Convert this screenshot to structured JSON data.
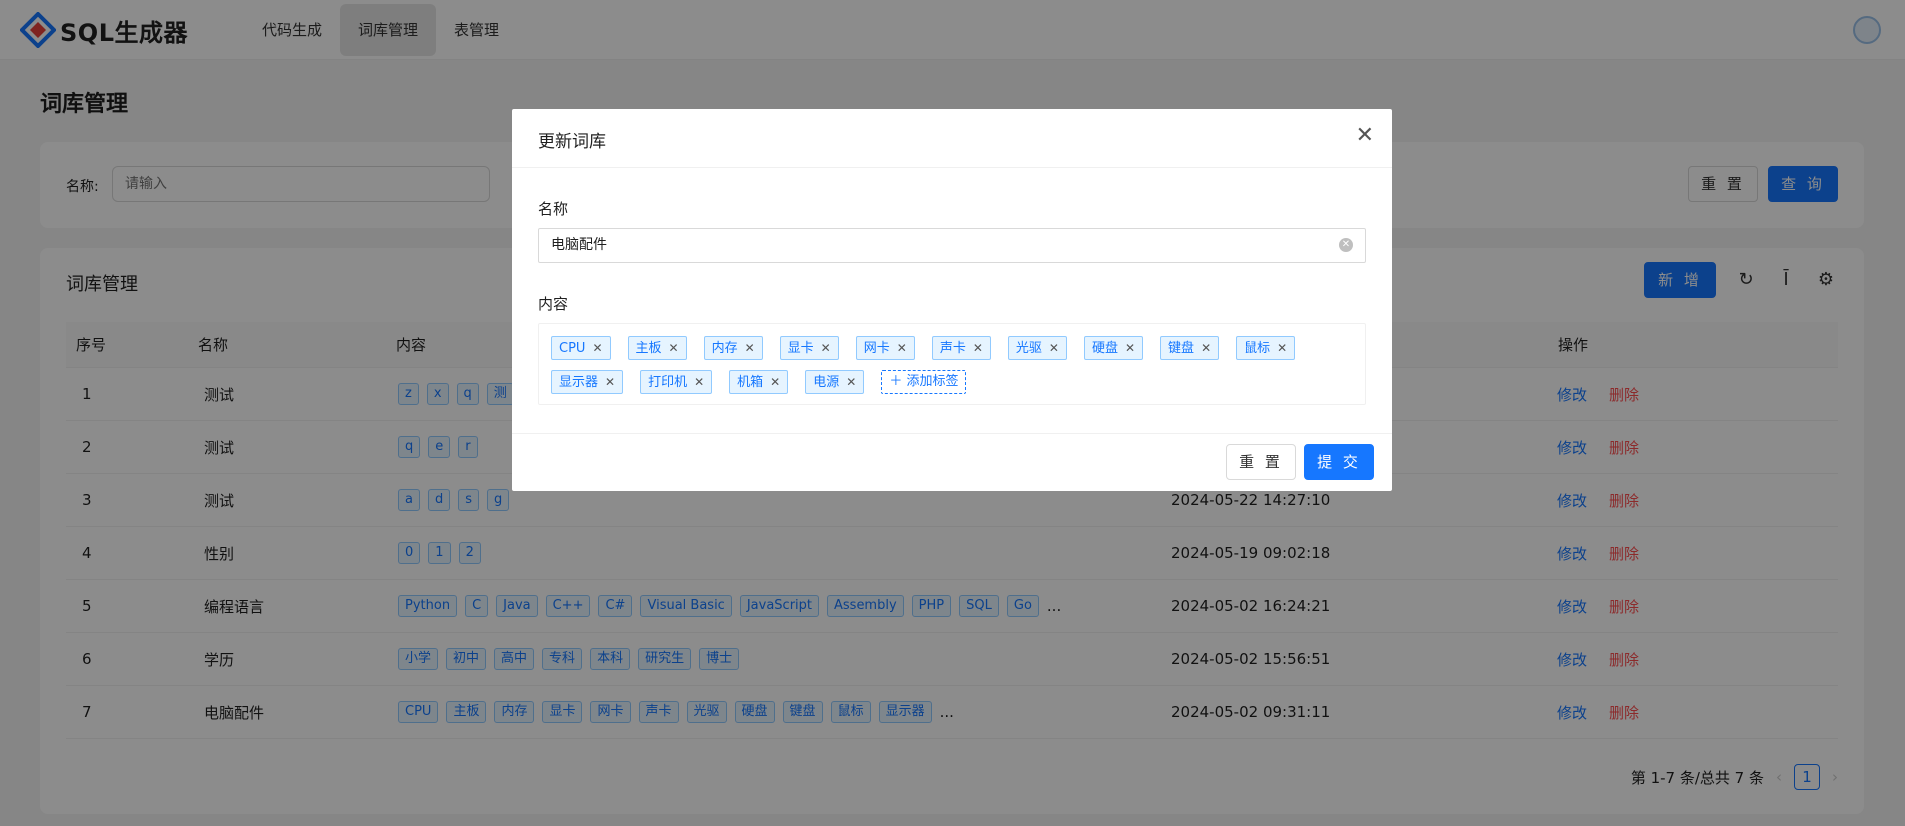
{
  "app": {
    "title": "SQL生成器"
  },
  "nav": {
    "items": [
      {
        "label": "代码生成"
      },
      {
        "label": "词库管理"
      },
      {
        "label": "表管理"
      }
    ]
  },
  "page": {
    "title": "词库管理"
  },
  "search": {
    "label": "名称:",
    "placeholder": "请输入",
    "reset_label": "重 置",
    "query_label": "查 询"
  },
  "table_card": {
    "title": "词库管理",
    "add_label": "新 增",
    "columns": [
      "序号",
      "名称",
      "内容",
      "操作"
    ],
    "edit_label": "修改",
    "delete_label": "删除",
    "rows": [
      {
        "id": "1",
        "name": "测试",
        "tags": [
          "z",
          "x",
          "q",
          "测"
        ],
        "more": "",
        "time": ""
      },
      {
        "id": "2",
        "name": "测试",
        "tags": [
          "q",
          "e",
          "r"
        ],
        "more": "",
        "time": ""
      },
      {
        "id": "3",
        "name": "测试",
        "tags": [
          "a",
          "d",
          "s",
          "g"
        ],
        "more": "",
        "time": "2024-05-22 14:27:10"
      },
      {
        "id": "4",
        "name": "性别",
        "tags": [
          "0",
          "1",
          "2"
        ],
        "more": "",
        "time": "2024-05-19 09:02:18"
      },
      {
        "id": "5",
        "name": "编程语言",
        "tags": [
          "Python",
          "C",
          "Java",
          "C++",
          "C#",
          "Visual Basic",
          "JavaScript",
          "Assembly",
          "PHP",
          "SQL",
          "Go"
        ],
        "more": "...",
        "time": "2024-05-02 16:24:21"
      },
      {
        "id": "6",
        "name": "学历",
        "tags": [
          "小学",
          "初中",
          "高中",
          "专科",
          "本科",
          "研究生",
          "博士"
        ],
        "more": "",
        "time": "2024-05-02 15:56:51"
      },
      {
        "id": "7",
        "name": "电脑配件",
        "tags": [
          "CPU",
          "主板",
          "内存",
          "显卡",
          "网卡",
          "声卡",
          "光驱",
          "硬盘",
          "键盘",
          "鼠标",
          "显示器"
        ],
        "more": "...",
        "time": "2024-05-02 09:31:11"
      }
    ],
    "pagination": {
      "summary": "第 1-7 条/总共 7 条",
      "current": "1"
    }
  },
  "modal": {
    "title": "更新词库",
    "name_label": "名称",
    "name_value": "电脑配件",
    "content_label": "内容",
    "tags_row1": [
      "CPU",
      "主板",
      "内存",
      "显卡",
      "网卡",
      "声卡",
      "光驱",
      "硬盘",
      "键盘",
      "鼠标"
    ],
    "tags_row2": [
      "显示器",
      "打印机",
      "机箱",
      "电源"
    ],
    "add_tag_label": "添加标签",
    "reset_label": "重 置",
    "submit_label": "提 交"
  },
  "colors": {
    "primary": "#1677ff",
    "danger": "#ff4d4f",
    "tag_bg": "#e6f4ff",
    "tag_border": "#91caff"
  },
  "icons": [
    "logo-icon",
    "avatar-icon",
    "reload-icon",
    "density-icon",
    "settings-icon",
    "close-icon",
    "clear-icon",
    "plus-icon",
    "prev-page-icon",
    "next-page-icon",
    "sort-icon"
  ]
}
